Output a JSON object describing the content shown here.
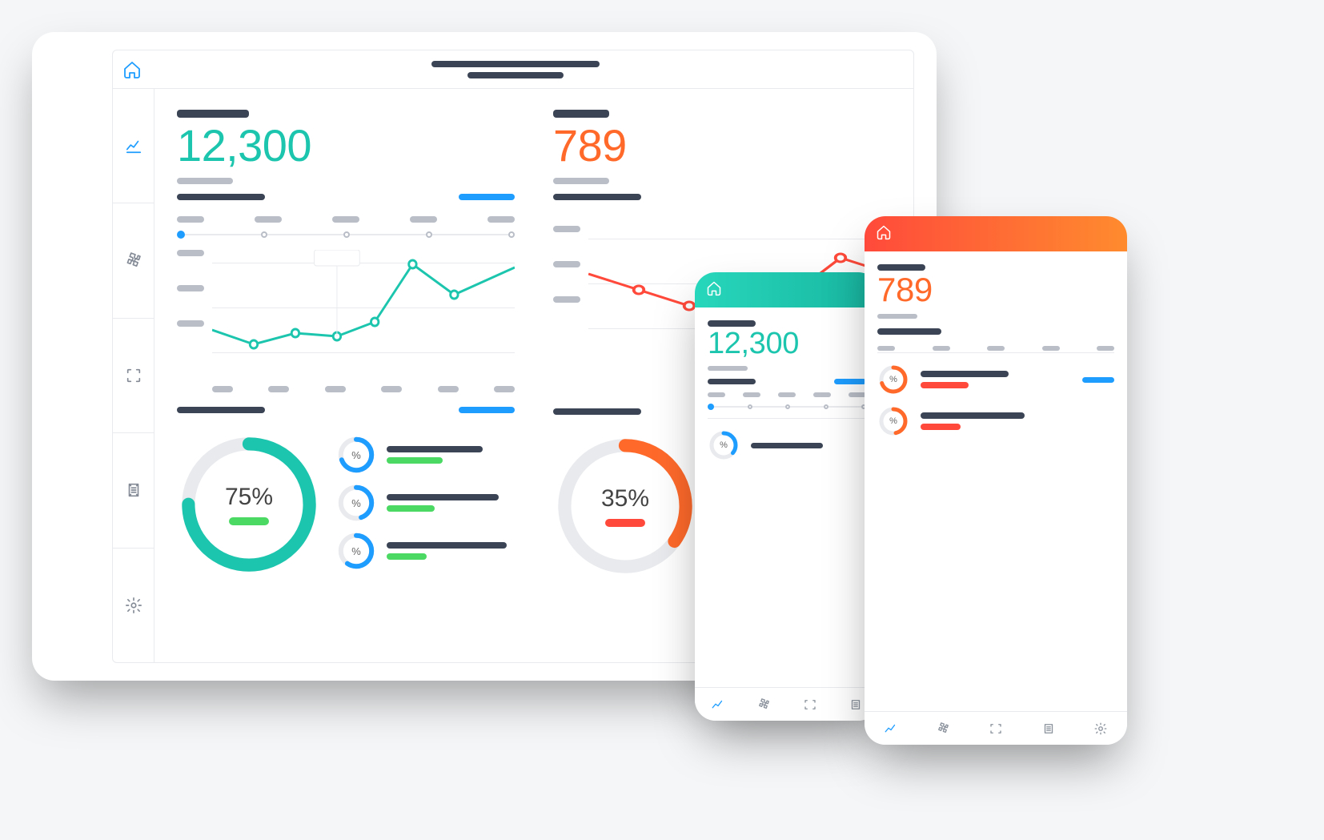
{
  "metrics": {
    "primary": {
      "value": "12,300",
      "color": "teal"
    },
    "secondary": {
      "value": "789",
      "color": "orange"
    }
  },
  "donuts": {
    "primary": {
      "percent": 75,
      "label": "75%",
      "color": "#1cc5ad",
      "accent": "#4bd964"
    },
    "secondary": {
      "percent": 35,
      "label": "35%",
      "color": "#ff8b2e",
      "accent": "#ff4a3b"
    }
  },
  "mini_metrics": {
    "symbol": "%"
  },
  "chart_data": [
    {
      "id": "teal-area",
      "type": "line",
      "color": "#1cc5ad",
      "x": [
        0,
        1,
        2,
        3,
        4,
        5,
        6,
        7
      ],
      "values": [
        42,
        30,
        38,
        36,
        48,
        92,
        70,
        90
      ],
      "ylim": [
        0,
        100
      ],
      "markers": true,
      "gridlines": 3,
      "notes": "placeholder labels only; no numeric tick labels visible"
    },
    {
      "id": "orange-area",
      "type": "line",
      "color": "#ff5a3b",
      "x": [
        0,
        1,
        2,
        3,
        4,
        5,
        6
      ],
      "values": [
        62,
        48,
        36,
        28,
        42,
        72,
        60
      ],
      "ylim": [
        0,
        100
      ],
      "markers": true,
      "gridlines": 3
    },
    {
      "id": "teal-donut",
      "type": "pie",
      "values": [
        75,
        25
      ],
      "colors": [
        "#1cc5ad",
        "#e8eaed"
      ],
      "center_label": "75%"
    },
    {
      "id": "orange-donut",
      "type": "pie",
      "values": [
        35,
        65
      ],
      "colors": [
        "#ff8b2e",
        "#e8eaed"
      ],
      "center_label": "35%"
    }
  ],
  "nav_icons": [
    "home",
    "chart-line",
    "puzzle",
    "scan",
    "list",
    "gear"
  ],
  "phone_nav_icons": [
    "chart-line",
    "puzzle",
    "scan",
    "list",
    "gear"
  ]
}
